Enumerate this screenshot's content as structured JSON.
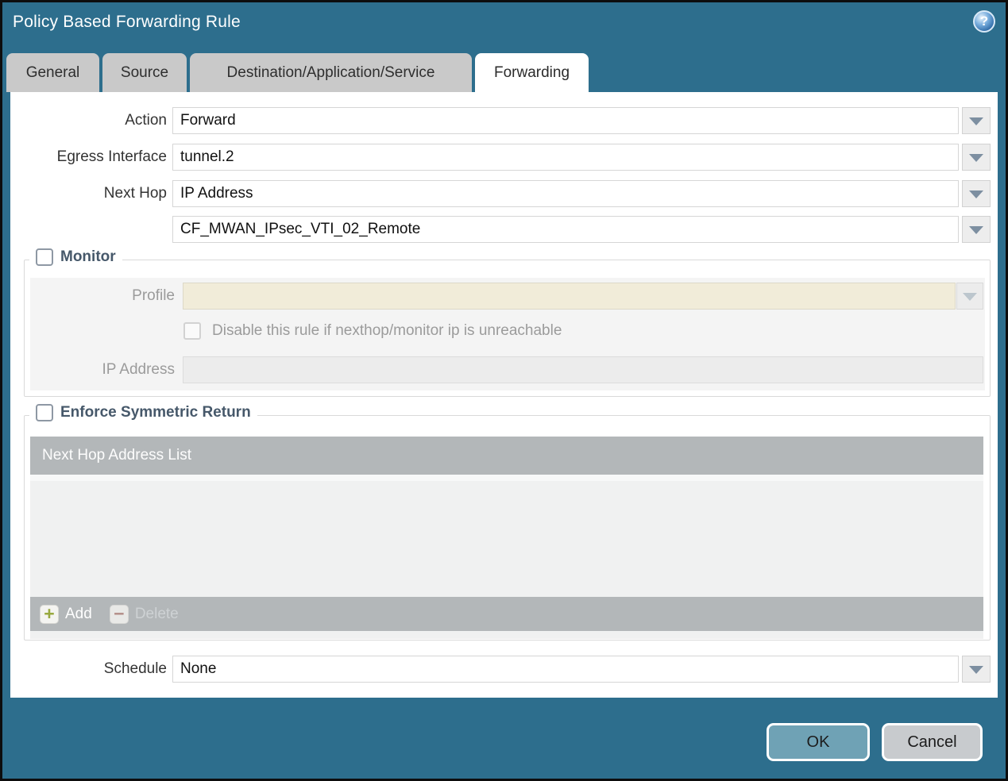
{
  "colors": {
    "chrome_teal": "#2d6e8d",
    "tab_inactive_gray": "#c9c9c9",
    "panel_white": "#ffffff",
    "disabled_field_cream": "#f1ecd9",
    "disabled_field_gray": "#ececec",
    "table_chrome_gray": "#b3b7b9",
    "legend_text": "#46586a",
    "ok_button": "#6fa2b5",
    "cancel_button": "#c8cbce"
  },
  "dialog": {
    "title": "Policy Based Forwarding Rule"
  },
  "icons": {
    "help": "?",
    "add": "+",
    "delete": "−"
  },
  "tabs": [
    {
      "label": "General",
      "active": false
    },
    {
      "label": "Source",
      "active": false
    },
    {
      "label": "Destination/Application/Service",
      "active": false
    },
    {
      "label": "Forwarding",
      "active": true
    }
  ],
  "form": {
    "action": {
      "label": "Action",
      "value": "Forward"
    },
    "egress_interface": {
      "label": "Egress Interface",
      "value": "tunnel.2"
    },
    "next_hop": {
      "label": "Next Hop",
      "value": "IP Address"
    },
    "next_hop_address": {
      "value": "CF_MWAN_IPsec_VTI_02_Remote"
    },
    "schedule": {
      "label": "Schedule",
      "value": "None"
    }
  },
  "monitor": {
    "legend": "Monitor",
    "checked": false,
    "profile": {
      "label": "Profile",
      "value": ""
    },
    "disable_rule": {
      "label": "Disable this rule if nexthop/monitor ip is unreachable",
      "checked": false
    },
    "ip_address": {
      "label": "IP Address",
      "value": ""
    }
  },
  "symmetric_return": {
    "legend": "Enforce Symmetric Return",
    "checked": false,
    "table": {
      "header": "Next Hop Address List",
      "rows": []
    },
    "add_label": "Add",
    "delete_label": "Delete"
  },
  "footer": {
    "ok_label": "OK",
    "cancel_label": "Cancel"
  }
}
